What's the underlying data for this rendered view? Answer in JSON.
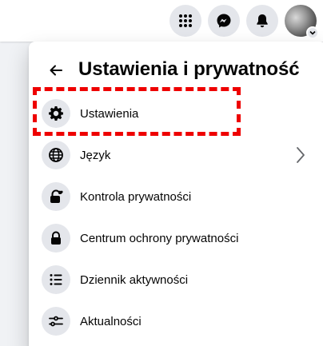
{
  "topbar": {
    "icons": [
      "grid-menu-icon",
      "messenger-icon",
      "bell-icon",
      "avatar"
    ]
  },
  "panel": {
    "title": "Ustawienia i prywatność",
    "items": [
      {
        "label": "Ustawienia",
        "icon": "gear-icon"
      },
      {
        "label": "Język",
        "icon": "globe-icon",
        "has_submenu": true
      },
      {
        "label": "Kontrola prywatności",
        "icon": "lock-heart-icon"
      },
      {
        "label": "Centrum ochrony prywatności",
        "icon": "lock-icon"
      },
      {
        "label": "Dziennik aktywności",
        "icon": "list-icon"
      },
      {
        "label": "Aktualności",
        "icon": "sliders-icon"
      }
    ]
  },
  "highlight": {
    "color": "#ee0000",
    "target": "Ustawienia"
  }
}
